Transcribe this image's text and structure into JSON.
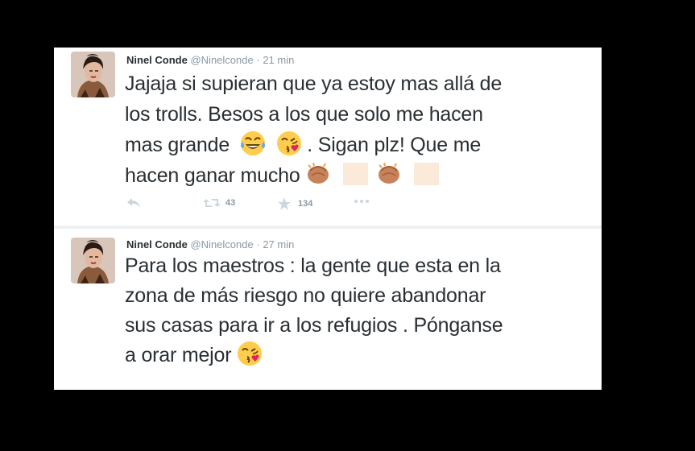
{
  "tweets": [
    {
      "name": "Ninel Conde",
      "handle": "@Ninelconde",
      "separator": "·",
      "time": "21 min",
      "lines": [
        "Jajaja si supieran que ya estoy mas allá de",
        "los trolls. Besos a los que solo me hacen",
        "mas grande",
        ". Sigan plz! Que me",
        "hacen ganar mucho"
      ],
      "retweets": "43",
      "favorites": "134"
    },
    {
      "name": "Ninel Conde",
      "handle": "@Ninelconde",
      "separator": "·",
      "time": "27 min",
      "lines": [
        "Para los maestros : la gente que esta en la",
        "zona de más riesgo no quiere abandonar",
        "sus casas para ir a los refugios . Pónganse",
        "a orar mejor"
      ]
    }
  ],
  "icons": {
    "reply": "reply-icon",
    "retweet": "retweet-icon",
    "favorite": "star-icon",
    "more": "more-icon",
    "emoji_tears": "face-with-tears-of-joy-icon",
    "emoji_kiss": "face-blowing-kiss-icon",
    "emoji_clap": "clapping-hands-icon"
  },
  "colors": {
    "text": "#292f33",
    "meta": "#8899a6",
    "background": "#000000",
    "card": "#ffffff"
  }
}
